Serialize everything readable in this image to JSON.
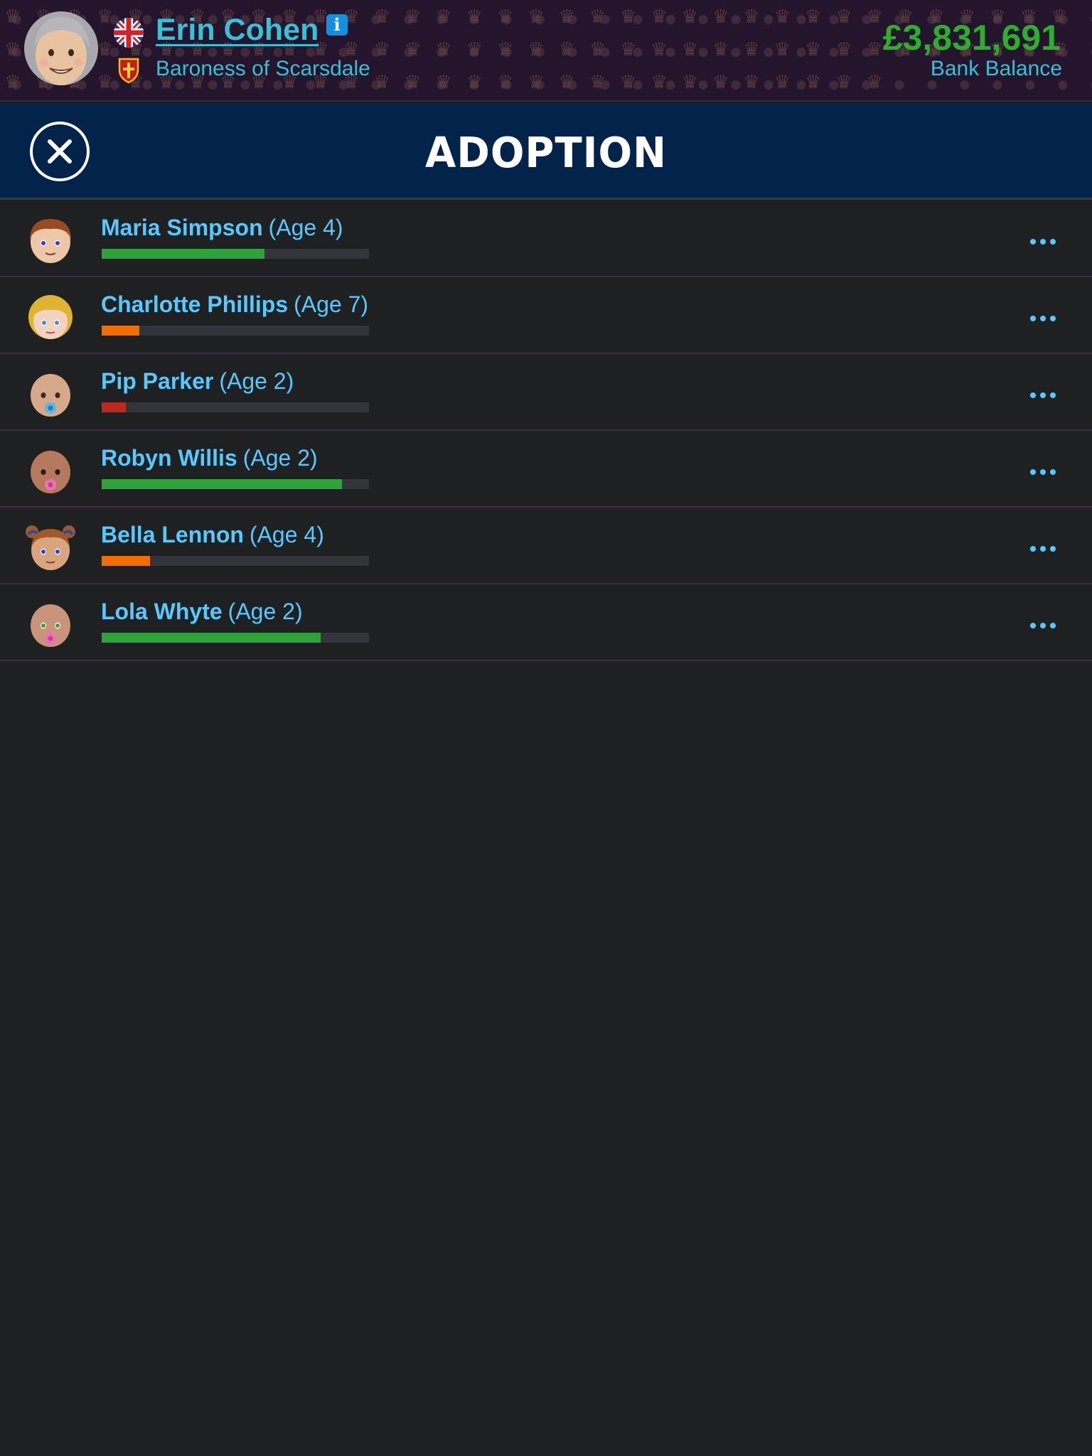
{
  "header": {
    "player_name": "Erin Cohen",
    "player_title": "Baroness of Scarsdale",
    "bank_balance": "£3,831,691",
    "bank_balance_label": "Bank Balance",
    "info_icon": "info-icon",
    "flag_icon": "uk-flag-icon",
    "crest_icon": "crest-icon"
  },
  "titlebar": {
    "title": "ADOPTION",
    "close_icon": "close-icon"
  },
  "children": [
    {
      "name": "Maria Simpson",
      "age": "(Age 4)",
      "bar_fraction": 0.61,
      "bar_color": "#2ea33a",
      "avatar": "boy-brown-hair"
    },
    {
      "name": "Charlotte Phillips",
      "age": "(Age 7)",
      "bar_fraction": 0.14,
      "bar_color": "#f56c00",
      "avatar": "girl-blonde-hair"
    },
    {
      "name": "Pip Parker",
      "age": "(Age 2)",
      "bar_fraction": 0.09,
      "bar_color": "#c0271f",
      "avatar": "baby-blue-pacifier"
    },
    {
      "name": "Robyn Willis",
      "age": "(Age 2)",
      "bar_fraction": 0.9,
      "bar_color": "#2ea33a",
      "avatar": "baby-pink-pacifier"
    },
    {
      "name": "Bella Lennon",
      "age": "(Age 4)",
      "bar_fraction": 0.18,
      "bar_color": "#f56c00",
      "avatar": "girl-pigtails"
    },
    {
      "name": "Lola Whyte",
      "age": "(Age 2)",
      "bar_fraction": 0.82,
      "bar_color": "#2ea33a",
      "avatar": "baby-green-eyes-pink-pacifier"
    }
  ],
  "colors": {
    "accent": "#36c1d8",
    "name_blue": "#58c8ff",
    "balance_green": "#2eae2e",
    "titlebar_bg": "#03244a",
    "page_bg": "#1f2022"
  }
}
